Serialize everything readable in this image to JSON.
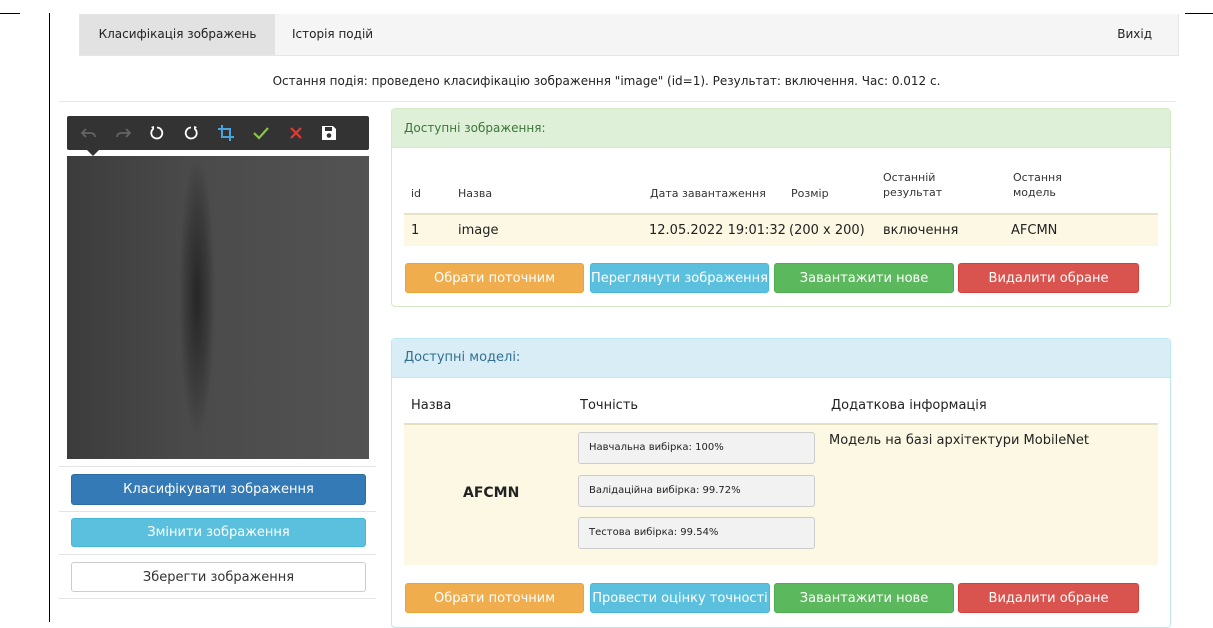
{
  "nav": {
    "classify": "Класифікація зображень",
    "history": "Історія подій",
    "exit": "Вихід"
  },
  "status": "Остання подія: проведено класифікацію зображення \"image\" (id=1). Результат: включення. Час: 0.012 с.",
  "toolbar": {
    "icons": [
      "undo-icon",
      "redo-icon",
      "rotate-left-icon",
      "rotate-right-icon",
      "crop-icon",
      "check-icon",
      "close-icon",
      "save-icon"
    ]
  },
  "left_buttons": {
    "classify": "Класифікувати зображення",
    "change": "Змінити зображення",
    "save": "Зберегти зображення"
  },
  "images_panel": {
    "title": "Доступні зображення:",
    "columns": [
      "id",
      "Назва",
      "Дата завантаження",
      "Розмір",
      "Останній\nрезультат",
      "Остання\nмодель"
    ],
    "rows": [
      {
        "id": "1",
        "name": "image",
        "date": "12.05.2022 19:01:32",
        "size": "(200 x 200)",
        "result": "включення",
        "model": "AFCMN"
      }
    ],
    "buttons": {
      "select": "Обрати поточним",
      "view": "Переглянути зображення",
      "upload": "Завантажити нове",
      "delete": "Видалити обране"
    }
  },
  "models_panel": {
    "title": "Доступні моделі:",
    "columns": {
      "name": "Назва",
      "accuracy": "Точність",
      "info": "Додаткова інформація"
    },
    "rows": [
      {
        "name": "AFCMN",
        "train": "Навчальна вибірка: 100%",
        "val": "Валідаційна вибірка: 99.72%",
        "test": "Тестова вибірка: 99.54%",
        "info": "Модель на базі архітектури MobileNet"
      }
    ],
    "buttons": {
      "select": "Обрати поточним",
      "evaluate": "Провести оцінку точності",
      "upload": "Завантажити нове",
      "delete": "Видалити обране"
    }
  },
  "colors": {
    "primary": "#337ab7",
    "info": "#5bc0de",
    "warning": "#f0ad4e",
    "success": "#5cb85c",
    "danger": "#d9534f",
    "toolbar_check": "#8bc34a",
    "toolbar_close": "#e53935",
    "toolbar_crop": "#4aa3df"
  }
}
